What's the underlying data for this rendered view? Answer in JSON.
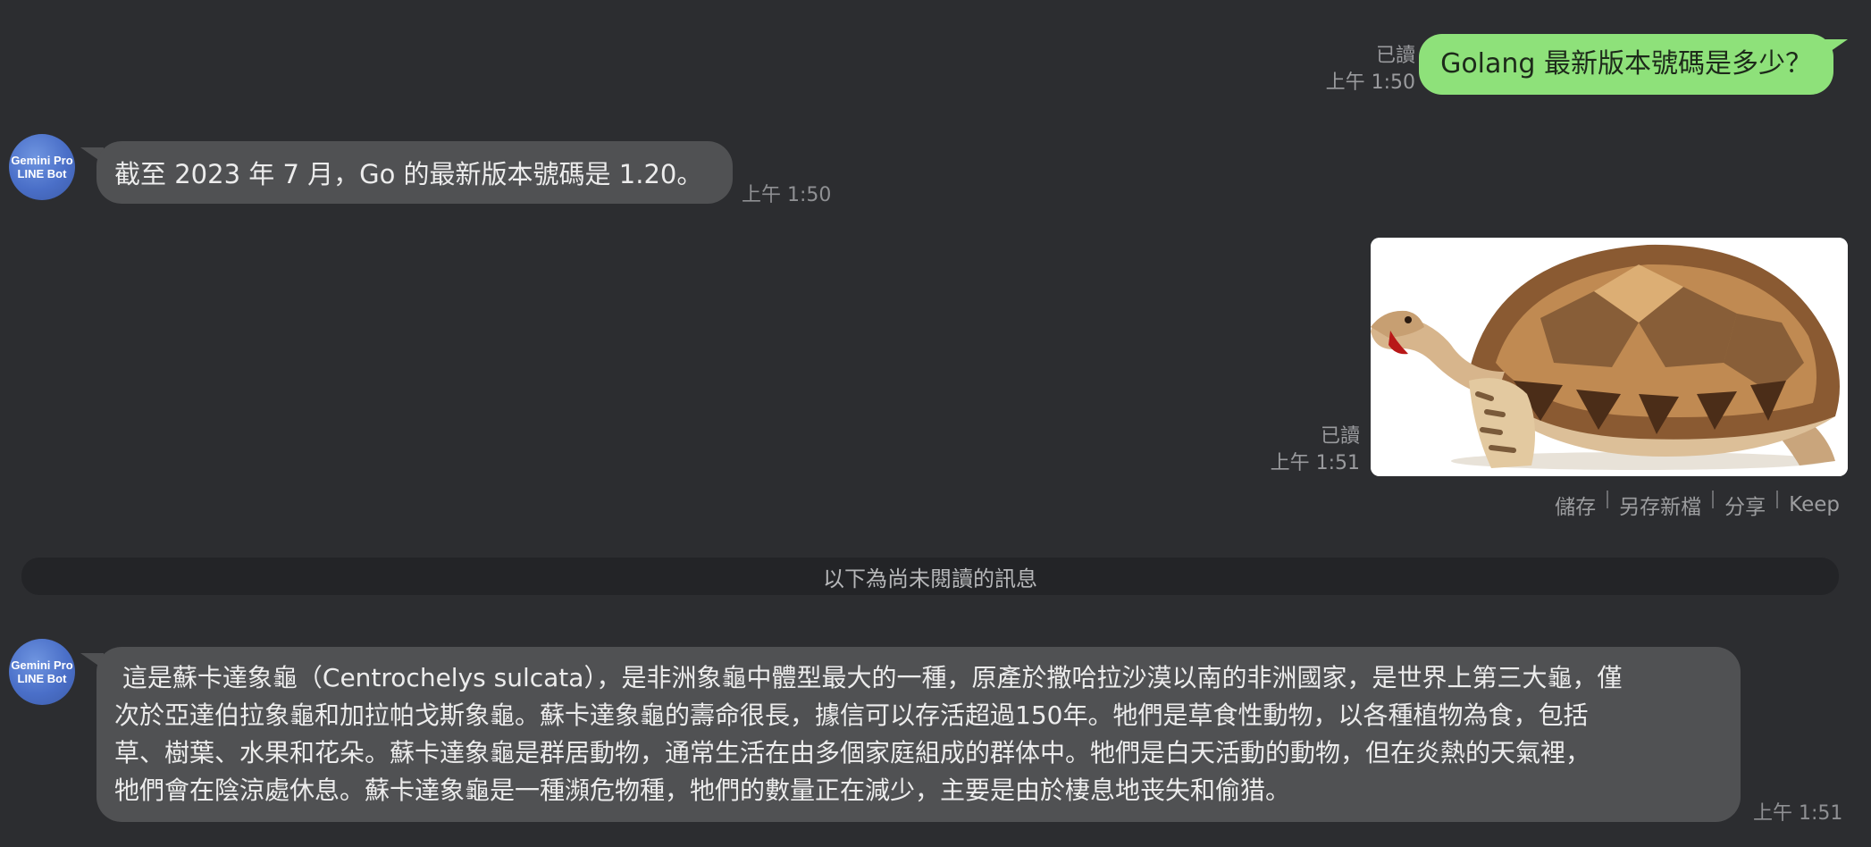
{
  "messages": {
    "m1": {
      "text": "Golang 最新版本號碼是多少？",
      "read": "已讀",
      "time": "上午 1:50"
    },
    "m2": {
      "avatar_line1": "Gemini Pro",
      "avatar_line2": "LINE Bot",
      "text": "截至 2023 年 7 月，Go 的最新版本號碼是 1.20。",
      "time": "上午 1:50"
    },
    "m3": {
      "read": "已讀",
      "time": "上午 1:51",
      "image_icon": "tortoise-photo"
    },
    "m4": {
      "avatar_line1": "Gemini Pro",
      "avatar_line2": "LINE Bot",
      "lines": [
        " 這是蘇卡達象龜（Centrochelys sulcata），是非洲象龜中體型最大的一種，原產於撒哈拉沙漠以南的非洲國家，是世界上第三大龜，僅",
        "次於亞達伯拉象龜和加拉帕戈斯象龜。蘇卡達象龜的壽命很長，據信可以存活超過150年。牠們是草食性動物，以各種植物為食，包括",
        "草、樹葉、水果和花朵。蘇卡達象龜是群居動物，通常生活在由多個家庭組成的群体中。牠們是白天活動的動物，但在炎熱的天氣裡，",
        "牠們會在陰涼處休息。蘇卡達象龜是一種瀕危物種，牠們的數量正在減少，主要是由於棲息地丧失和偷猎。"
      ],
      "time": "上午 1:51"
    }
  },
  "image_actions": {
    "save": "儲存",
    "save_as": "另存新檔",
    "share": "分享",
    "keep": "Keep"
  },
  "unread_divider": "以下為尚未閱讀的訊息",
  "colors": {
    "background": "#2c2d30",
    "outgoing_bubble": "#8ee17a",
    "incoming_bubble": "#505153"
  }
}
